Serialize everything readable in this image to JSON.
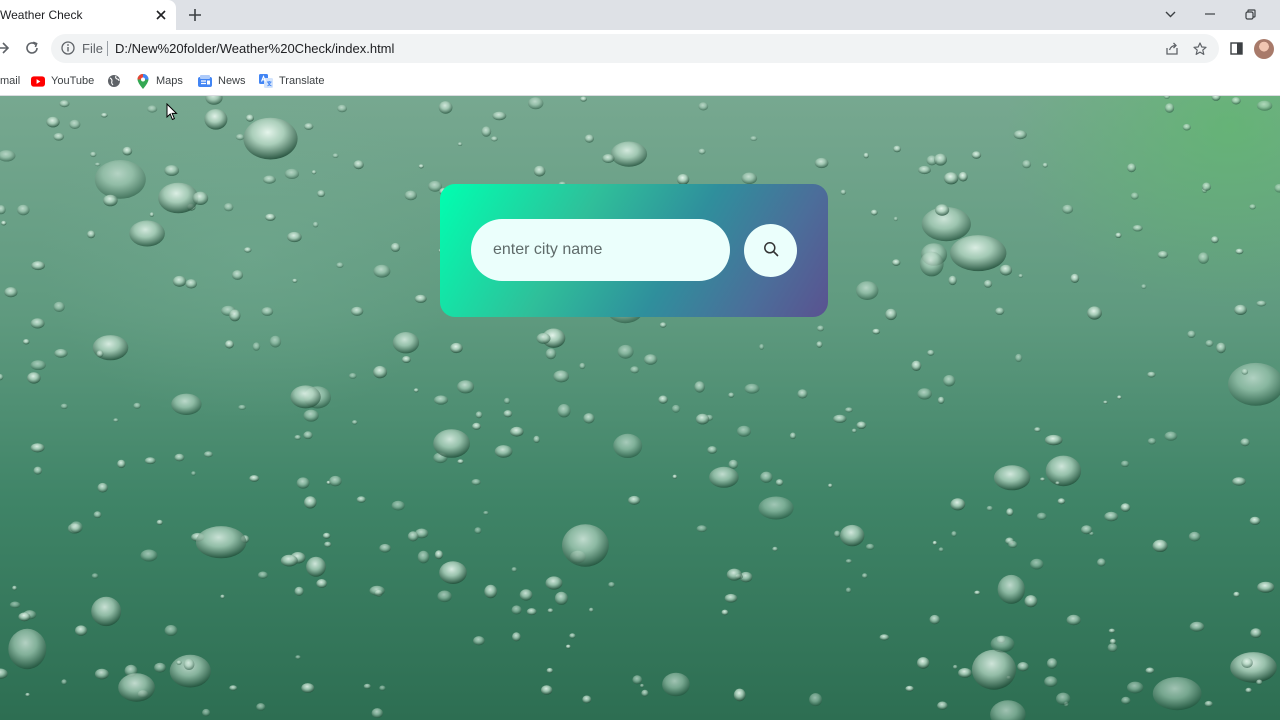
{
  "browser": {
    "tab": {
      "title": "Weather Check",
      "close_icon": "close-icon"
    },
    "new_tab_icon": "plus-icon",
    "window_controls": [
      "chevron-down-icon",
      "minimize-icon",
      "restore-icon"
    ],
    "toolbar": {
      "icons": [
        "forward-arrow-icon",
        "reload-icon"
      ],
      "omnibox": {
        "security_label": "File",
        "url": "D:/New%20folder/Weather%20Check/index.html",
        "icons": [
          "share-icon",
          "star-icon"
        ]
      },
      "side_panel_icon": "side-panel-icon",
      "profile_icon": "avatar"
    },
    "bookmarks": [
      {
        "label": "mail",
        "icon": "gmail-icon"
      },
      {
        "label": "YouTube",
        "icon": "youtube-icon"
      },
      {
        "label": "",
        "icon": "globe-icon"
      },
      {
        "label": "Maps",
        "icon": "maps-icon"
      },
      {
        "label": "News",
        "icon": "news-icon"
      },
      {
        "label": "Translate",
        "icon": "translate-icon"
      }
    ]
  },
  "page": {
    "search": {
      "placeholder": "enter city name",
      "value": "",
      "button_icon": "search-icon"
    },
    "colors": {
      "card_gradient_start": "#00ffb0",
      "card_gradient_end": "#5a5290",
      "input_background": "#ebfffc"
    }
  }
}
